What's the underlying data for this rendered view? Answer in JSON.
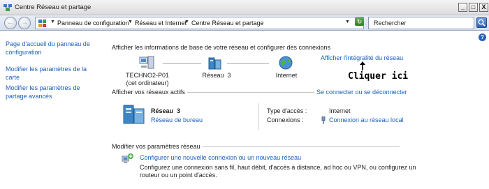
{
  "window": {
    "title": "Centre Réseau et partage",
    "minimize_glyph": "_",
    "maximize_glyph": "□",
    "close_glyph": "X"
  },
  "addressbar": {
    "back_glyph": "←",
    "forward_glyph": "→",
    "crumbs": [
      "Panneau de configuration",
      "Réseau et Internet",
      "Centre Réseau et partage"
    ],
    "refresh_glyph": "↻",
    "search_value": "Rechercher"
  },
  "sidebar": {
    "links": [
      "Page d'accueil du panneau de configuration",
      "Modifier les paramètres de la carte",
      "Modifier les paramètres de partage avancés"
    ]
  },
  "main": {
    "help_glyph": "?",
    "heading": "Afficher les informations de base de votre réseau et configurer des connexions",
    "full_map_link": "Afficher l'intégralité du réseau",
    "map": {
      "computer_name": "TECHNO2-P01",
      "computer_sub": "(cet ordinateur)",
      "network_name": "Réseau  3",
      "internet": "Internet"
    },
    "annotation": "Cliquer ici",
    "active": {
      "title": "Afficher vos réseaux actifs",
      "connect_link": "Se connecter ou se déconnecter",
      "network_name": "Réseau  3",
      "network_type": "Réseau de bureau",
      "access_label": "Type d'accès :",
      "access_value": "Internet",
      "connections_label": "Connexions :",
      "connections_value": "Connexion au réseau local"
    },
    "modify": {
      "title": "Modifier vos paramètres réseau",
      "new_connection_link": "Configurer une nouvelle connexion ou un nouveau réseau",
      "new_connection_desc_1": "Configurez une connexion sans fil, haut débit, d'accès à distance, ad hoc ou VPN, ou configurez un",
      "new_connection_desc_2": "routeur ou un point d'accès."
    }
  }
}
